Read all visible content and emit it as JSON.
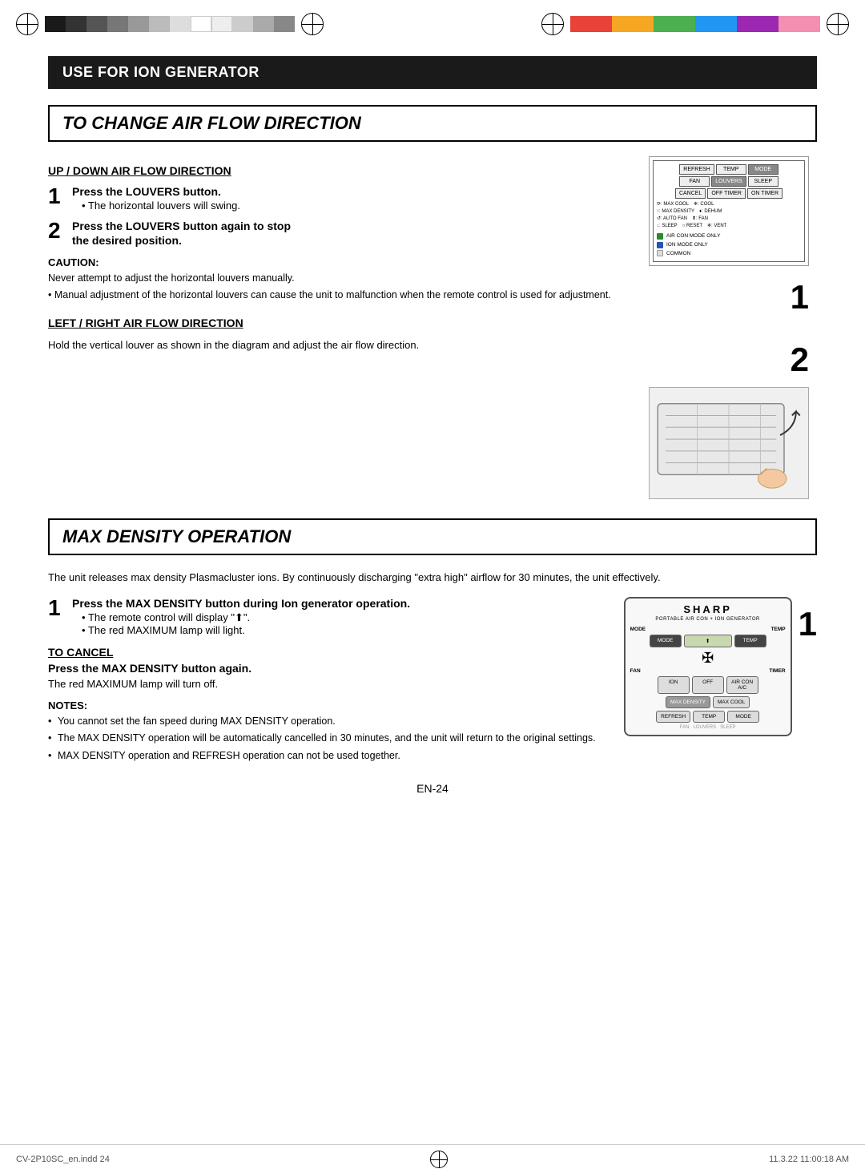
{
  "top_colors_left": [
    "#1a1a1a",
    "#333",
    "#555",
    "#777",
    "#999",
    "#bbb",
    "#ddd",
    "#fff",
    "#eee",
    "#ccc",
    "#aaa",
    "#888"
  ],
  "top_colors_right": [
    "#e8423a",
    "#e8423a",
    "#f5a623",
    "#f5a623",
    "#4caf50",
    "#4caf50",
    "#2196f3",
    "#2196f3",
    "#9c27b0",
    "#9c27b0",
    "#f48fb1",
    "#f48fb1"
  ],
  "header": {
    "section_title": "USE FOR ION GENERATOR"
  },
  "air_flow": {
    "title": "TO CHANGE AIR FLOW DIRECTION",
    "up_down": {
      "heading": "UP / DOWN AIR FLOW DIRECTION",
      "step1_bold": "Press the LOUVERS button.",
      "step1_bullet": "The horizontal louvers will swing.",
      "step2_bold": "Press the LOUVERS button again to stop",
      "step2_bold2": "the desired position.",
      "caution_label": "CAUTION:",
      "caution_line1": "Never attempt to adjust the horizontal louvers manually.",
      "caution_line2": "• Manual adjustment of the horizontal louvers can cause the unit to malfunction when the remote control is used for adjustment."
    },
    "left_right": {
      "heading": "LEFT / RIGHT AIR FLOW DIRECTION",
      "text": "Hold the vertical louver as shown in the diagram and adjust the air flow direction."
    }
  },
  "remote": {
    "rows": [
      [
        "REFRESH",
        "TEMP",
        "MODE"
      ],
      [
        "FAN",
        "LOUVERS",
        "SLEEP"
      ],
      [
        "CANCEL",
        "OFF TIMER",
        "ON TIMER"
      ]
    ],
    "legend": [
      {
        "color": "green",
        "label": "AIR CON MODE ONLY"
      },
      {
        "color": "blue",
        "label": "ION MODE ONLY"
      },
      {
        "color": "white",
        "label": "COMMON"
      }
    ],
    "sub_legend": [
      "⟳ : MAX COOL",
      "↑ : MAX DENSITY",
      "↺ : AUTO FAN",
      "↓ : SLEEP",
      "○ RESET",
      "❄ : COOL",
      "♦ : DEHUM",
      "⬆ : FAN",
      "❄ : VENT"
    ]
  },
  "max_density": {
    "title": "MAX DENSITY OPERATION",
    "description": "The unit releases max density Plasmacluster ions. By continuously discharging \"extra high\" airflow for 30 minutes, the unit effectively.",
    "step1_bold": "Press the MAX DENSITY button during Ion generator operation.",
    "step1_bullet1": "The remote control will display \"⬆\".",
    "step1_bullet2": "The red MAXIMUM lamp will light.",
    "cancel_heading": "TO CANCEL",
    "cancel_bold": "Press the MAX DENSITY button again.",
    "cancel_bullet": "The red MAXIMUM lamp will turn off.",
    "notes_label": "NOTES:",
    "notes": [
      "You cannot set the fan speed during MAX DENSITY operation.",
      "The MAX DENSITY operation will be automatically cancelled in 30 minutes, and the unit will return to the original settings.",
      "MAX DENSITY operation and REFRESH operation can not be used together."
    ]
  },
  "sharp_remote": {
    "brand": "SHARP",
    "subtitle": "PORTABLE AIR CON + ION GENERATOR",
    "labels_top": [
      "MODE",
      "TEMP"
    ],
    "display_char": "⬆",
    "fan_label": "FAN",
    "timer_label": "TIMER",
    "ion_label": "ION",
    "off_label": "OFF",
    "aircon_label": "AIR CON",
    "ac_label": "A/C",
    "max_density_label": "MAX DENSITY",
    "max_cool_label": "MAX COOL",
    "refresh_label": "REFRESH",
    "temp_label": "TEMP",
    "mode_label": "MODE"
  },
  "step_numbers_right": [
    "1",
    "2"
  ],
  "step_number_bottom": "1",
  "page": {
    "number": "EN-24",
    "footer_left": "CV-2P10SC_en.indd  24",
    "footer_right": "11.3.22  11:00:18 AM"
  }
}
